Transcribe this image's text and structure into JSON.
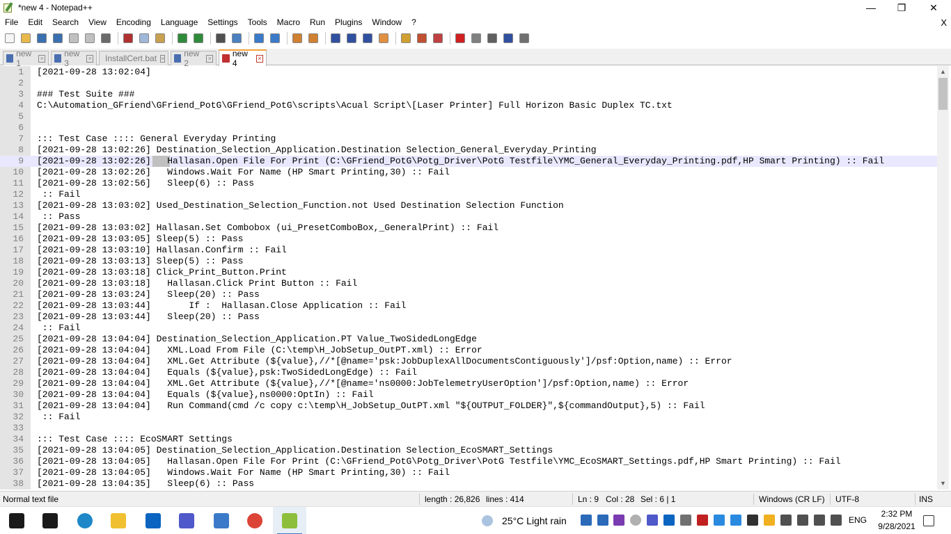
{
  "window": {
    "title": "*new 4 - Notepad++",
    "minimize": "—",
    "maximize": "❐",
    "close": "✕"
  },
  "menu": {
    "items": [
      "File",
      "Edit",
      "Search",
      "View",
      "Encoding",
      "Language",
      "Settings",
      "Tools",
      "Macro",
      "Run",
      "Plugins",
      "Window",
      "?"
    ],
    "close_doc": "X"
  },
  "toolbar": {
    "buttons": [
      {
        "name": "new-file-icon",
        "color": "#f5f5f5"
      },
      {
        "name": "open-file-icon",
        "color": "#e8b84a"
      },
      {
        "name": "save-icon",
        "color": "#3a6fb0"
      },
      {
        "name": "save-all-icon",
        "color": "#3a6fb0"
      },
      {
        "name": "close-icon",
        "color": "#c0c0c0"
      },
      {
        "name": "close-all-icon",
        "color": "#c0c0c0"
      },
      {
        "name": "print-icon",
        "color": "#6a6a6a"
      },
      {
        "name": "cut-icon",
        "color": "#b03030"
      },
      {
        "name": "copy-icon",
        "color": "#9fb7d8"
      },
      {
        "name": "paste-icon",
        "color": "#c8a050"
      },
      {
        "name": "undo-icon",
        "color": "#2f8a3a"
      },
      {
        "name": "redo-icon",
        "color": "#2f8a3a"
      },
      {
        "name": "find-icon",
        "color": "#505050"
      },
      {
        "name": "replace-icon",
        "color": "#4a80c0"
      },
      {
        "name": "zoom-in-icon",
        "color": "#3a7ac8"
      },
      {
        "name": "zoom-out-icon",
        "color": "#3a7ac8"
      },
      {
        "name": "sync-vertical-icon",
        "color": "#d08030"
      },
      {
        "name": "sync-horizontal-icon",
        "color": "#d08030"
      },
      {
        "name": "word-wrap-icon",
        "color": "#3050a0"
      },
      {
        "name": "show-all-chars-icon",
        "color": "#3050a0"
      },
      {
        "name": "indent-guide-icon",
        "color": "#3050a0"
      },
      {
        "name": "doc-map-icon",
        "color": "#e09040"
      },
      {
        "name": "function-list-icon",
        "color": "#d0a030"
      },
      {
        "name": "folder-workspace-icon",
        "color": "#c05030"
      },
      {
        "name": "monitoring-icon",
        "color": "#c04040"
      },
      {
        "name": "record-macro-icon",
        "color": "#d02020"
      },
      {
        "name": "stop-record-icon",
        "color": "#808080"
      },
      {
        "name": "play-macro-icon",
        "color": "#606060"
      },
      {
        "name": "run-macro-multiple-icon",
        "color": "#3050a0"
      },
      {
        "name": "save-macro-icon",
        "color": "#707070"
      }
    ]
  },
  "tabs": [
    {
      "label": "new 1",
      "active": false,
      "icon_color": "#4a6fb0"
    },
    {
      "label": "new 3",
      "active": false,
      "icon_color": "#4a6fb0"
    },
    {
      "label": "InstallCert.bat",
      "active": false,
      "icon_color": "#4a6fb0"
    },
    {
      "label": "new 2",
      "active": false,
      "icon_color": "#4a6fb0"
    },
    {
      "label": "new 4",
      "active": true,
      "icon_color": "#c03030"
    }
  ],
  "editor": {
    "current_line": 9,
    "lines": [
      {
        "n": "1",
        "t": "[2021-09-28 13:02:04]"
      },
      {
        "n": "2",
        "t": ""
      },
      {
        "n": "3",
        "t": "### Test Suite ###"
      },
      {
        "n": "4",
        "t": "C:\\Automation_GFriend\\GFriend_PotG\\GFriend_PotG\\scripts\\Acual Script\\[Laser Printer] Full Horizon Basic Duplex TC.txt"
      },
      {
        "n": "5",
        "t": ""
      },
      {
        "n": "6",
        "t": ""
      },
      {
        "n": "7",
        "t": "::: Test Case :::: General Everyday Printing"
      },
      {
        "n": "8",
        "t": "[2021-09-28 13:02:26] Destination_Selection_Application.Destination Selection_General_Everyday_Printing"
      },
      {
        "n": "9",
        "t": "[2021-09-28 13:02:26]   Hallasan.Open File For Print (C:\\GFriend_PotG\\Potg_Driver\\PotG Testfile\\YMC_General_Everyday_Printing.pdf,HP Smart Printing) :: Fail"
      },
      {
        "n": "10",
        "t": "[2021-09-28 13:02:26]   Windows.Wait For Name (HP Smart Printing,30) :: Fail"
      },
      {
        "n": "11",
        "t": "[2021-09-28 13:02:56]   Sleep(6) :: Pass"
      },
      {
        "n": "12",
        "t": " :: Fail"
      },
      {
        "n": "13",
        "t": "[2021-09-28 13:03:02] Used_Destination_Selection_Function.not Used Destination Selection Function"
      },
      {
        "n": "14",
        "t": " :: Pass"
      },
      {
        "n": "15",
        "t": "[2021-09-28 13:03:02] Hallasan.Set Combobox (ui_PresetComboBox,_GeneralPrint) :: Fail"
      },
      {
        "n": "16",
        "t": "[2021-09-28 13:03:05] Sleep(5) :: Pass"
      },
      {
        "n": "17",
        "t": "[2021-09-28 13:03:10] Hallasan.Confirm :: Fail"
      },
      {
        "n": "18",
        "t": "[2021-09-28 13:03:13] Sleep(5) :: Pass"
      },
      {
        "n": "19",
        "t": "[2021-09-28 13:03:18] Click_Print_Button.Print"
      },
      {
        "n": "20",
        "t": "[2021-09-28 13:03:18]   Hallasan.Click Print Button :: Fail"
      },
      {
        "n": "21",
        "t": "[2021-09-28 13:03:24]   Sleep(20) :: Pass"
      },
      {
        "n": "22",
        "t": "[2021-09-28 13:03:44]       If :  Hallasan.Close Application :: Fail"
      },
      {
        "n": "23",
        "t": "[2021-09-28 13:03:44]   Sleep(20) :: Pass"
      },
      {
        "n": "24",
        "t": " :: Fail"
      },
      {
        "n": "25",
        "t": "[2021-09-28 13:04:04] Destination_Selection_Application.PT Value_TwoSidedLongEdge"
      },
      {
        "n": "26",
        "t": "[2021-09-28 13:04:04]   XML.Load From File (C:\\temp\\H_JobSetup_OutPT.xml) :: Error"
      },
      {
        "n": "27",
        "t": "[2021-09-28 13:04:04]   XML.Get Attribute (${value},//*[@name='psk:JobDuplexAllDocumentsContiguously']/psf:Option,name) :: Error"
      },
      {
        "n": "28",
        "t": "[2021-09-28 13:04:04]   Equals (${value},psk:TwoSidedLongEdge) :: Fail"
      },
      {
        "n": "29",
        "t": "[2021-09-28 13:04:04]   XML.Get Attribute (${value},//*[@name='ns0000:JobTelemetryUserOption']/psf:Option,name) :: Error"
      },
      {
        "n": "30",
        "t": "[2021-09-28 13:04:04]   Equals (${value},ns0000:OptIn) :: Fail"
      },
      {
        "n": "31",
        "t": "[2021-09-28 13:04:04]   Run Command(cmd /c copy c:\\temp\\H_JobSetup_OutPT.xml \"${OUTPUT_FOLDER}\",${commandOutput},5) :: Fail"
      },
      {
        "n": "32",
        "t": " :: Fail"
      },
      {
        "n": "33",
        "t": ""
      },
      {
        "n": "34",
        "t": "::: Test Case :::: EcoSMART Settings"
      },
      {
        "n": "35",
        "t": "[2021-09-28 13:04:05] Destination_Selection_Application.Destination Selection_EcoSMART_Settings"
      },
      {
        "n": "36",
        "t": "[2021-09-28 13:04:05]   Hallasan.Open File For Print (C:\\GFriend_PotG\\Potg_Driver\\PotG Testfile\\YMC_EcoSMART_Settings.pdf,HP Smart Printing) :: Fail"
      },
      {
        "n": "37",
        "t": "[2021-09-28 13:04:05]   Windows.Wait For Name (HP Smart Printing,30) :: Fail"
      },
      {
        "n": "38",
        "t": "[2021-09-28 13:04:35]   Sleep(6) :: Pass"
      }
    ]
  },
  "status": {
    "file_type": "Normal text file",
    "length": "length : 26,826",
    "lines": "lines : 414",
    "ln": "Ln : 9",
    "col": "Col : 28",
    "sel": "Sel : 6 | 1",
    "eol": "Windows (CR LF)",
    "encoding": "UTF-8",
    "mode": "INS"
  },
  "taskbar": {
    "apps": [
      {
        "name": "start-icon",
        "color": "#1a1a1a"
      },
      {
        "name": "task-view-icon",
        "color": "#1a1a1a"
      },
      {
        "name": "edge-icon",
        "color": "#1e88c8"
      },
      {
        "name": "file-explorer-icon",
        "color": "#f0c030"
      },
      {
        "name": "outlook-icon",
        "color": "#0a64c0"
      },
      {
        "name": "teams-icon",
        "color": "#5059c9"
      },
      {
        "name": "gfriend-app-icon",
        "color": "#3a7ac8"
      },
      {
        "name": "chrome-icon",
        "color": "#db4437"
      },
      {
        "name": "notepadpp-taskbar-icon",
        "color": "#8dbf3c"
      }
    ],
    "weather": "25°C  Light rain",
    "language": "ENG",
    "time": "2:32 PM",
    "date": "9/28/2021"
  }
}
